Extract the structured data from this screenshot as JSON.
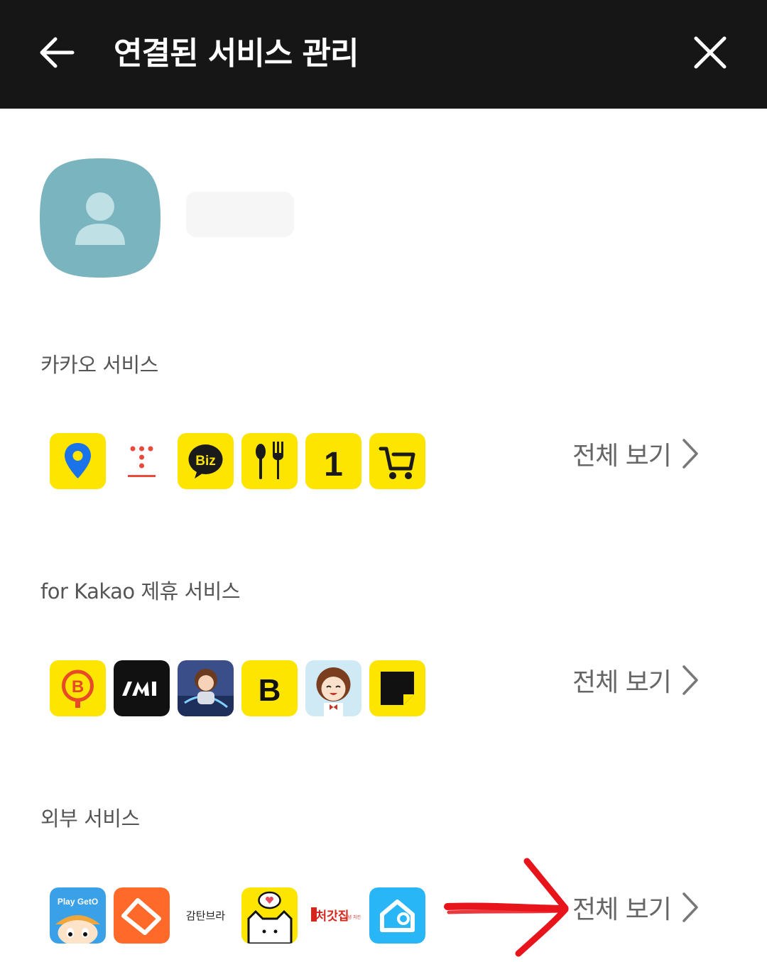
{
  "header": {
    "title": "연결된 서비스 관리",
    "back_icon": "arrow-left-icon",
    "close_icon": "close-icon"
  },
  "profile": {
    "avatar_icon": "person-icon",
    "avatar_color": "#79b4bf"
  },
  "sections": [
    {
      "label": "카카오 서비스",
      "view_all": "전체 보기",
      "apps": [
        "kakao-map",
        "kakao-t",
        "kakao-biz",
        "kakao-food",
        "kakao-one",
        "kakao-shopping"
      ]
    },
    {
      "label": "for Kakao 제휴 서비스",
      "view_all": "전체 보기",
      "apps": [
        "b-coin",
        "partner-black",
        "game-character-1",
        "kakao-page-b",
        "game-character-2",
        "kakao-sticky"
      ]
    },
    {
      "label": "외부 서비스",
      "view_all": "전체 보기",
      "apps": [
        "play-geto",
        "orange-house",
        "감탄브라",
        "cat-heart",
        "처갓집",
        "home-blue"
      ]
    }
  ],
  "wordmarks": {
    "play_geto": "Play GetO",
    "gamtan": "감탄브라",
    "cheogatjip": "처갓집",
    "cheogatjip_sub": "양념 치킨",
    "biz": "Biz",
    "one": "1",
    "b": "B"
  },
  "colors": {
    "kakao_yellow": "#fee500",
    "header_bg": "#161616",
    "annotation_red": "#e8141b"
  }
}
